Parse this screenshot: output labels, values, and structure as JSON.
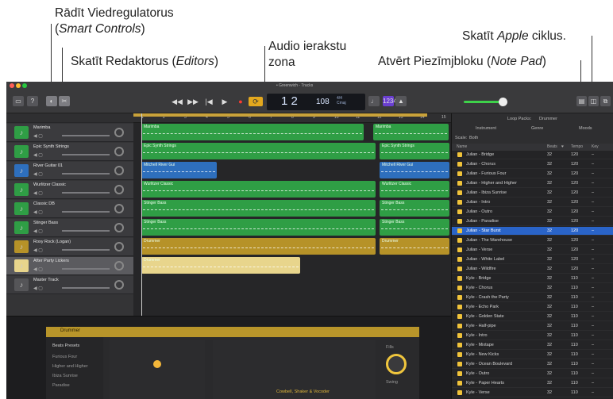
{
  "callouts": {
    "smart_controls_line1": "Rādīt Viedregulatorus",
    "smart_controls_line2_prefix": "(",
    "smart_controls_line2_italic": "Smart Controls",
    "smart_controls_line2_suffix": ")",
    "editors_prefix": "Skatīt Redaktorus (",
    "editors_italic": "Editors",
    "editors_suffix": ")",
    "audio_line1": "Audio ierakstu",
    "audio_line2": "zona",
    "apple_loops_prefix": "Skatīt ",
    "apple_loops_italic": "Apple",
    "apple_loops_suffix": " ciklus.",
    "note_pad_prefix": "Atvērt Piezīmjbloku (",
    "note_pad_italic": "Note Pad",
    "note_pad_suffix": ")"
  },
  "window": {
    "title": "• Greenwich - Tracks",
    "traffic_colors": [
      "#ff5f57",
      "#febc2e",
      "#28c840"
    ]
  },
  "lcd": {
    "position": "1  2",
    "tempo": "108",
    "key_top": "4/4",
    "key_bottom": "Cmaj"
  },
  "ruler": {
    "bars": [
      "1",
      "2",
      "3",
      "4",
      "5",
      "6",
      "7",
      "8",
      "9",
      "10",
      "11",
      "12",
      "13",
      "14",
      "15"
    ]
  },
  "tracks": [
    {
      "name": "Marimba",
      "color": "#2f9e45"
    },
    {
      "name": "Epic Synth Strings",
      "color": "#2f9e45"
    },
    {
      "name": "River Guitar 01",
      "color": "#2e6fbd"
    },
    {
      "name": "Wurlitzer Classic",
      "color": "#2f9e45"
    },
    {
      "name": "Classic DB",
      "color": "#2f9e45"
    },
    {
      "name": "Stinger Bass",
      "color": "#2f9e45"
    },
    {
      "name": "Roxy Rock (Logan)",
      "color": "#b69228"
    },
    {
      "name": "After Party Lickers",
      "color": "#e8d58c"
    },
    {
      "name": "Master Track",
      "color": "#555558"
    }
  ],
  "regions": {
    "marimba": "Marimba",
    "epic": "Epic Synth Strings",
    "guitar": "Mitchell River Gui",
    "wurli": "Wurlitzer Classic",
    "stinger1": "Stinger Bass",
    "stinger2": "Stinger Bass",
    "drummer": "Drummer",
    "drummer2": "Drummer"
  },
  "browser": {
    "tab_loops": "Loop Packs:",
    "tab_drummer": "Drummer",
    "filter_instrument": "Instrument",
    "filter_genre": "Genre",
    "filter_moods": "Moods",
    "scale_label": "Scale:",
    "scale_value": "Both",
    "col_name": "Name",
    "col_beats": "Beats",
    "col_fav": "♥",
    "col_tempo": "Tempo",
    "col_key": "Key",
    "loops": [
      {
        "name": "Julian - Bridge",
        "beats": "32",
        "tempo": "120",
        "key": "–"
      },
      {
        "name": "Julian - Chorus",
        "beats": "32",
        "tempo": "120",
        "key": "–"
      },
      {
        "name": "Julian - Furious Four",
        "beats": "32",
        "tempo": "120",
        "key": "–"
      },
      {
        "name": "Julian - Higher and Higher",
        "beats": "32",
        "tempo": "120",
        "key": "–"
      },
      {
        "name": "Julian - Ibiza Sunrise",
        "beats": "32",
        "tempo": "120",
        "key": "–"
      },
      {
        "name": "Julian - Intro",
        "beats": "32",
        "tempo": "120",
        "key": "–"
      },
      {
        "name": "Julian - Outro",
        "beats": "32",
        "tempo": "120",
        "key": "–"
      },
      {
        "name": "Julian - Paradise",
        "beats": "32",
        "tempo": "120",
        "key": "–"
      },
      {
        "name": "Julian - Star Burst",
        "beats": "32",
        "tempo": "120",
        "key": "–"
      },
      {
        "name": "Julian - The Warehouse",
        "beats": "32",
        "tempo": "120",
        "key": "–"
      },
      {
        "name": "Julian - Verse",
        "beats": "32",
        "tempo": "120",
        "key": "–"
      },
      {
        "name": "Julian - White Label",
        "beats": "32",
        "tempo": "120",
        "key": "–"
      },
      {
        "name": "Julian - Wildfire",
        "beats": "32",
        "tempo": "120",
        "key": "–"
      },
      {
        "name": "Kyle - Bridge",
        "beats": "32",
        "tempo": "110",
        "key": "–"
      },
      {
        "name": "Kyle - Chorus",
        "beats": "32",
        "tempo": "110",
        "key": "–"
      },
      {
        "name": "Kyle - Crash the Party",
        "beats": "32",
        "tempo": "110",
        "key": "–"
      },
      {
        "name": "Kyle - Echo Park",
        "beats": "32",
        "tempo": "110",
        "key": "–"
      },
      {
        "name": "Kyle - Golden State",
        "beats": "32",
        "tempo": "110",
        "key": "–"
      },
      {
        "name": "Kyle - Half-pipe",
        "beats": "32",
        "tempo": "110",
        "key": "–"
      },
      {
        "name": "Kyle - Intro",
        "beats": "32",
        "tempo": "110",
        "key": "–"
      },
      {
        "name": "Kyle - Mixtape",
        "beats": "32",
        "tempo": "110",
        "key": "–"
      },
      {
        "name": "Kyle - New Kicks",
        "beats": "32",
        "tempo": "110",
        "key": "–"
      },
      {
        "name": "Kyle - Ocean Boulevard",
        "beats": "32",
        "tempo": "110",
        "key": "–"
      },
      {
        "name": "Kyle - Outro",
        "beats": "32",
        "tempo": "110",
        "key": "–"
      },
      {
        "name": "Kyle - Paper Hearts",
        "beats": "32",
        "tempo": "110",
        "key": "–"
      },
      {
        "name": "Kyle - Verse",
        "beats": "32",
        "tempo": "110",
        "key": "–"
      }
    ]
  },
  "editor": {
    "header": "Drummer",
    "presets_title": "Beats Presets",
    "presets": [
      "Furious Four",
      "Higher and Higher",
      "Ibiza Sunrise",
      "Paradise"
    ],
    "knob_label": "Fills",
    "swing_label": "Swing",
    "foot_label": "Cowbell, Shaker & Vocoder"
  }
}
